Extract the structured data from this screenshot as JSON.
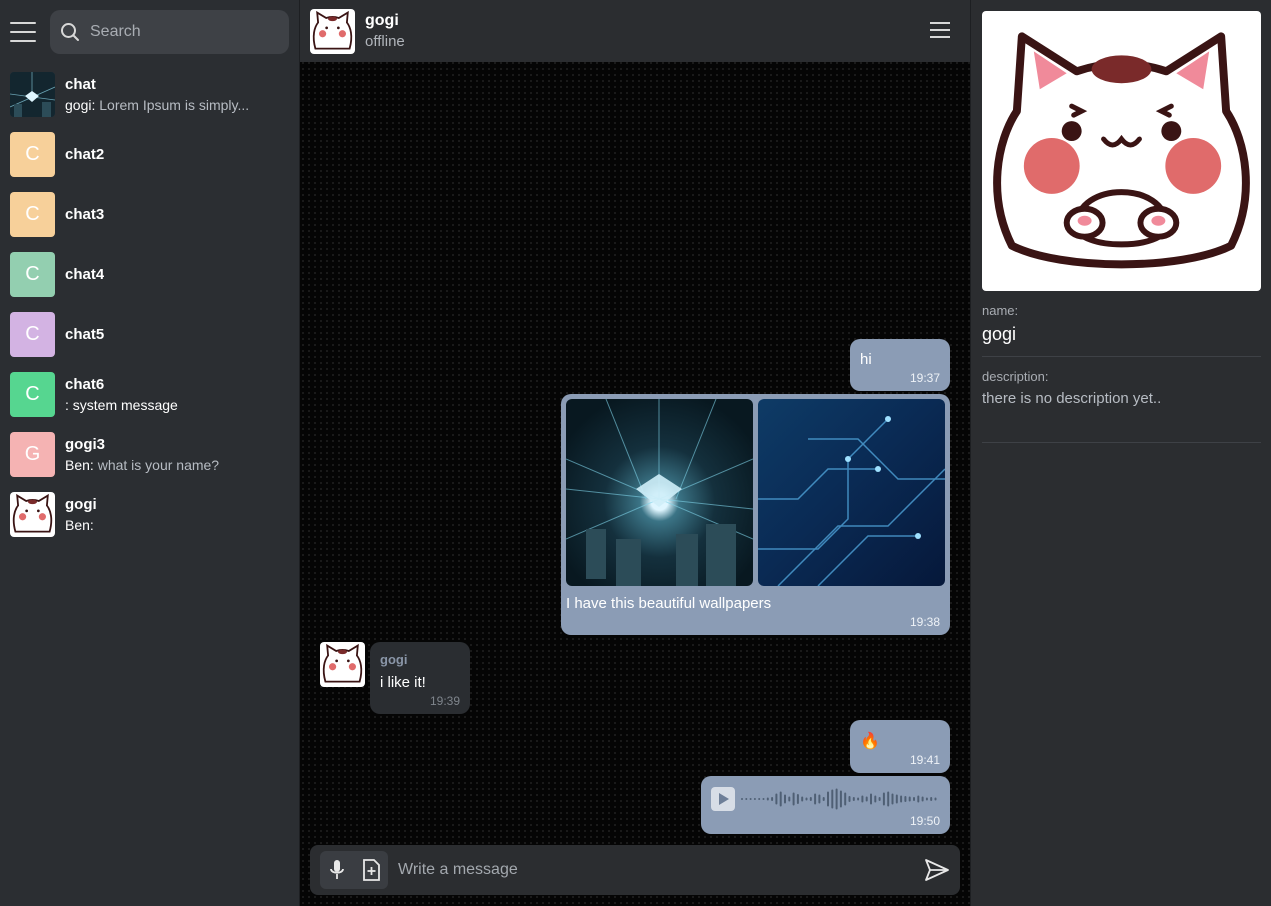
{
  "sidebar": {
    "search_placeholder": "Search",
    "chats": [
      {
        "name": "chat",
        "sender": "gogi:",
        "preview": "Lorem Ipsum is simply...",
        "avatar_type": "image",
        "avatar_letter": "",
        "avatar_color": "#1f3a4a"
      },
      {
        "name": "chat2",
        "sender": "",
        "preview": "",
        "avatar_type": "letter",
        "avatar_letter": "C",
        "avatar_color": "#f7d09a"
      },
      {
        "name": "chat3",
        "sender": "",
        "preview": "",
        "avatar_type": "letter",
        "avatar_letter": "C",
        "avatar_color": "#f7d09a"
      },
      {
        "name": "chat4",
        "sender": "",
        "preview": "",
        "avatar_type": "letter",
        "avatar_letter": "C",
        "avatar_color": "#93cfb0"
      },
      {
        "name": "chat5",
        "sender": "",
        "preview": "",
        "avatar_type": "letter",
        "avatar_letter": "C",
        "avatar_color": "#d3b3e3"
      },
      {
        "name": "chat6",
        "sender": ": system message",
        "preview": "",
        "avatar_type": "letter",
        "avatar_letter": "C",
        "avatar_color": "#56d690"
      },
      {
        "name": "gogi3",
        "sender": "Ben:",
        "preview": "what is your name?",
        "avatar_type": "letter",
        "avatar_letter": "G",
        "avatar_color": "#f5b3b3"
      },
      {
        "name": "gogi",
        "sender": "Ben:",
        "preview": "",
        "avatar_type": "cat",
        "avatar_letter": "",
        "avatar_color": "#ffffff"
      }
    ]
  },
  "header": {
    "name": "gogi",
    "status": "offline"
  },
  "messages": {
    "m1": {
      "text": "hi",
      "time": "19:37"
    },
    "m2": {
      "text": "I have this beautiful wallpapers",
      "time": "19:38"
    },
    "m3": {
      "author": "gogi",
      "text": "i like it!",
      "time": "19:39"
    },
    "m4": {
      "text": "🔥",
      "time": "19:41"
    },
    "m5": {
      "time": "19:50"
    }
  },
  "composer": {
    "placeholder": "Write a message"
  },
  "profile": {
    "name_label": "name:",
    "name": "gogi",
    "description_label": "description:",
    "description": "there is no description yet.."
  },
  "colors": {
    "outgoing_bubble": "#8b9cb5",
    "incoming_bubble": "#2a2d31",
    "panel": "#2b2d30"
  }
}
